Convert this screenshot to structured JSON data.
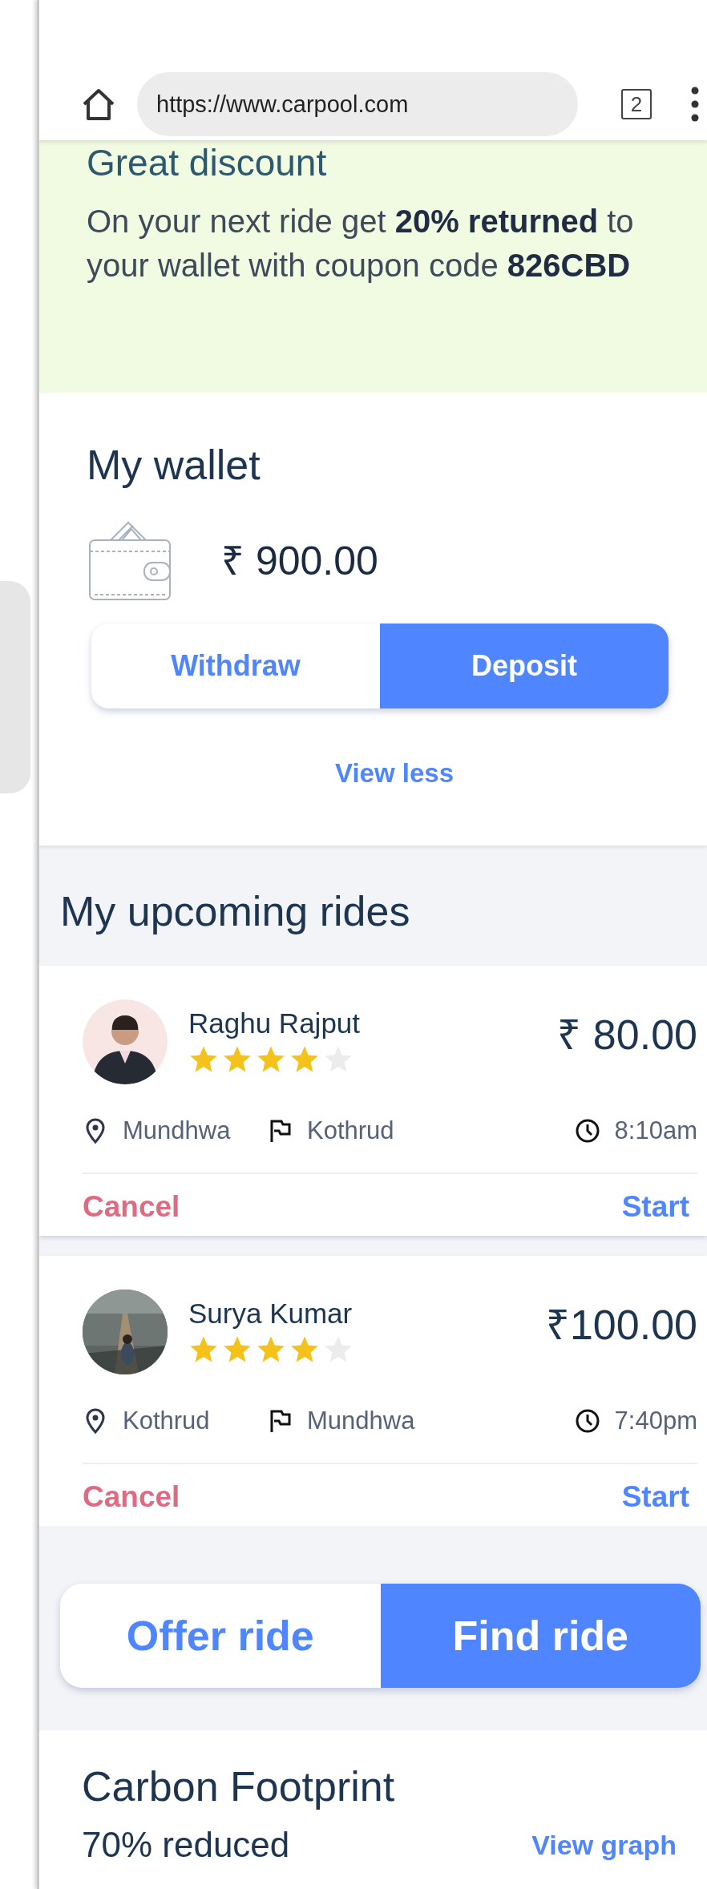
{
  "browser": {
    "url": "https://www.carpool.com",
    "tab_count": "2"
  },
  "promo": {
    "title": "Great discount",
    "text": "On your next ride get **20% returned** to your wallet with coupon code **826CBD**"
  },
  "wallet": {
    "title": "My wallet",
    "balance": "₹ 900.00",
    "actions": [
      {
        "label": "Withdraw",
        "selected": false
      },
      {
        "label": "Deposit",
        "selected": true
      }
    ],
    "toggle": "View less"
  },
  "upcoming": {
    "title": "My upcoming rides",
    "rides": [
      {
        "avatar": {
          "kind": "silhouette"
        },
        "name": "Raghu Rajput",
        "stars": 4,
        "price": "₹ 80.00",
        "from": "Mundhwa",
        "to": "Kothrud",
        "time": "8:10am",
        "cancel": "Cancel",
        "start": "Start"
      },
      {
        "name": "Surya Kumar",
        "stars": 4,
        "price": "₹100.00",
        "from": "Kothrud",
        "to": "Mundhwa",
        "time": "7:40pm",
        "cancel": "Cancel",
        "start": "Start"
      }
    ]
  },
  "ride_mode": [
    {
      "label": "Offer ride",
      "selected": false
    },
    {
      "label": "Find ride",
      "selected": true
    }
  ],
  "carbon": {
    "title": "Carbon Footprint",
    "summary": "70% reduced",
    "link": "View graph"
  }
}
